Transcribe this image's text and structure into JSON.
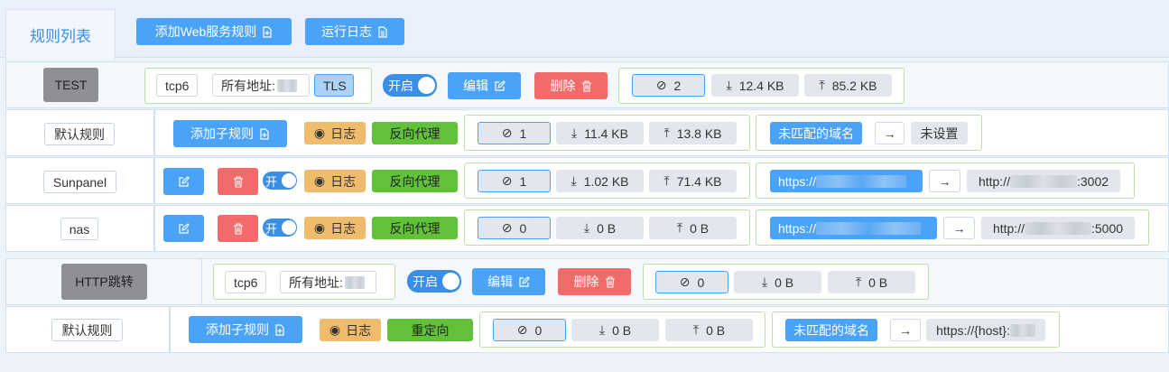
{
  "tabs": {
    "rules_list": "规则列表"
  },
  "toolbar": {
    "add_web_rule": "添加Web服务规则",
    "run_log": "运行日志"
  },
  "groups": [
    {
      "name": "TEST",
      "protocol": "tcp6",
      "address": "所有地址:",
      "tls": "TLS",
      "toggle": "开启",
      "edit": "编辑",
      "delete": "删除",
      "stats": {
        "conn": "2",
        "down": "12.4 KB",
        "up": "85.2 KB"
      },
      "default_rule": {
        "label": "默认规则",
        "add_sub": "添加子规则",
        "log": "日志",
        "type": "反向代理",
        "stats": {
          "conn": "1",
          "down": "11.4 KB",
          "up": "13.8 KB"
        },
        "match": "未匹配的域名",
        "target": "未设置"
      },
      "sub_rules": [
        {
          "name": "Sunpanel",
          "toggle": "开",
          "log": "日志",
          "type": "反向代理",
          "stats": {
            "conn": "1",
            "down": "1.02 KB",
            "up": "71.4 KB"
          },
          "source": "https://",
          "target_prefix": "http://",
          "target_port": ":3002"
        },
        {
          "name": "nas",
          "toggle": "开",
          "log": "日志",
          "type": "反向代理",
          "stats": {
            "conn": "0",
            "down": "0 B",
            "up": "0 B"
          },
          "source": "https://",
          "target_prefix": "http://",
          "target_port": ":5000"
        }
      ]
    },
    {
      "name": "HTTP跳转",
      "protocol": "tcp6",
      "address": "所有地址:",
      "toggle": "开启",
      "edit": "编辑",
      "delete": "删除",
      "stats": {
        "conn": "0",
        "down": "0 B",
        "up": "0 B"
      },
      "default_rule": {
        "label": "默认规则",
        "add_sub": "添加子规则",
        "log": "日志",
        "type": "重定向",
        "stats": {
          "conn": "0",
          "down": "0 B",
          "up": "0 B"
        },
        "match": "未匹配的域名",
        "target": "https://{host}:"
      }
    }
  ],
  "icons": {
    "add_doc": "document-add-icon",
    "doc": "document-icon",
    "edit": "edit-icon",
    "trash": "trash-icon",
    "eye": "eye-icon",
    "link": "link-icon",
    "download": "download-icon",
    "upload": "upload-icon",
    "arrow": "arrow-right-icon"
  },
  "colors": {
    "primary": "#4ba3f7",
    "danger": "#f26b6b",
    "warning": "#efbc6e",
    "success": "#61c13b"
  }
}
